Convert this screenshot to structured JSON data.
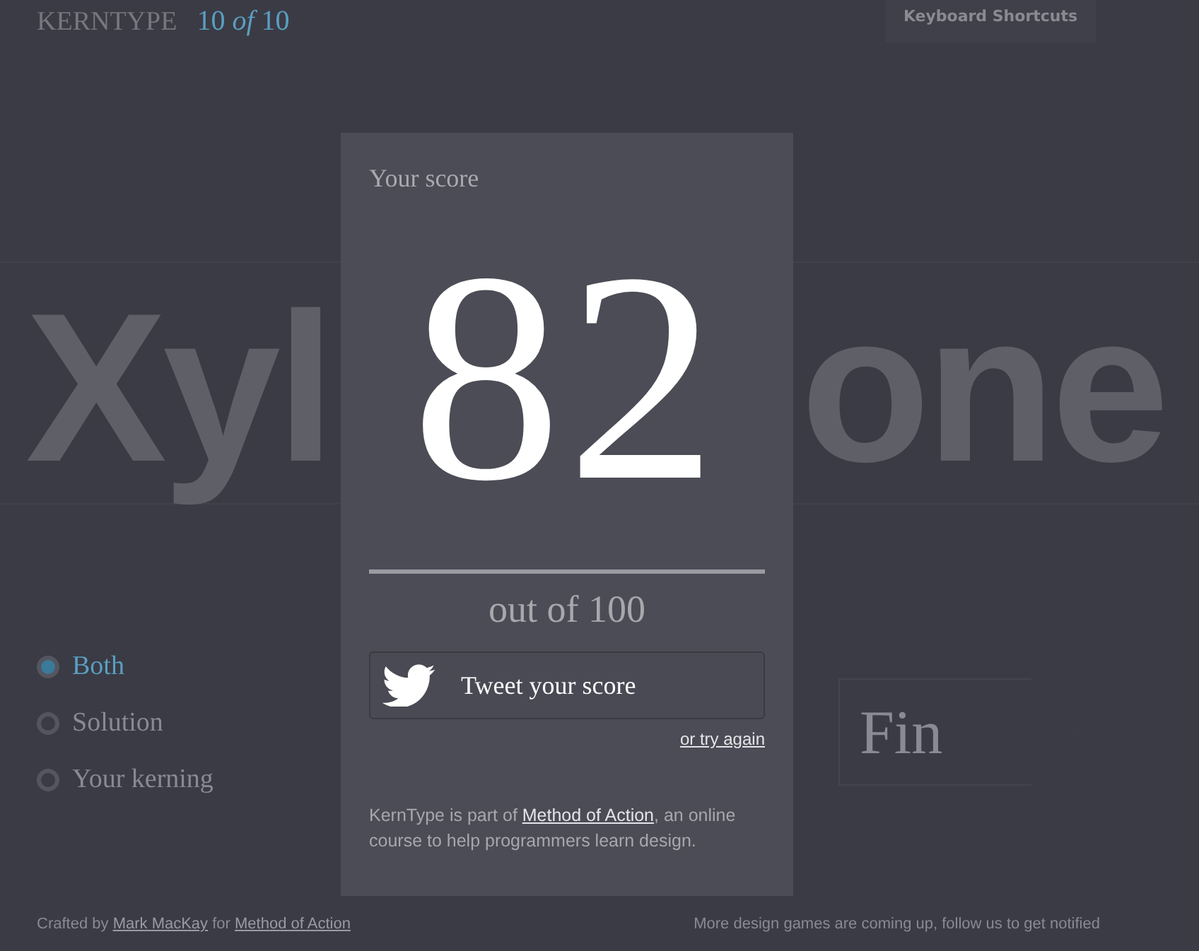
{
  "header": {
    "logo": "KERNTYPE",
    "progress": "10 *of* 10",
    "shortcuts_button": "Keyboard Shortcuts"
  },
  "word": {
    "left": "Xyl",
    "right": "one"
  },
  "view_options": [
    {
      "label": "Both",
      "selected": true
    },
    {
      "label": "Solution",
      "selected": false
    },
    {
      "label": "Your kerning",
      "selected": false
    }
  ],
  "next_button": "Fin",
  "footer": {
    "credit_prefix": "Crafted by",
    "author": "Mark MacKay",
    "credit_middle": "for",
    "site": "Method of Action",
    "notice": "More design games are coming up, follow us to get notified"
  },
  "score_dialog": {
    "title": "Your score",
    "score": "82",
    "out_of": "out of 100",
    "tweet_button": "Tweet your score",
    "retry_link": "or try again",
    "about_prefix": "KernType is part of",
    "about_link": "Method of Action",
    "about_suffix": ", an online course to help programmers learn design."
  }
}
